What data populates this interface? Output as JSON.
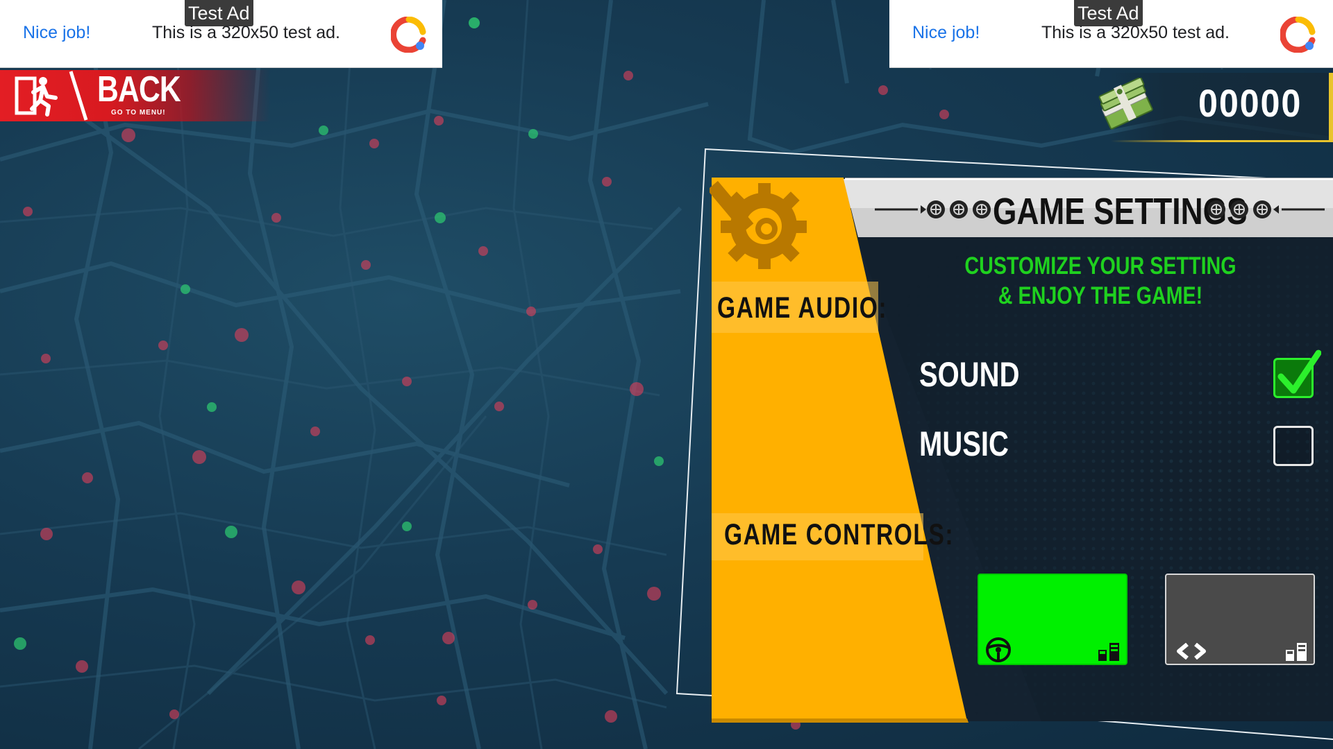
{
  "ads": [
    {
      "tag": "Test Ad",
      "nice": "Nice job!",
      "text": "This is a 320x50 test ad."
    },
    {
      "tag": "Test Ad",
      "nice": "Nice job!",
      "text": "This is a 320x50 test ad."
    }
  ],
  "back": {
    "label": "BACK",
    "sublabel": "GO TO MENU!",
    "icon": "exit-running-man-icon"
  },
  "currency": {
    "icon": "cash-stack-icon",
    "value": "00000"
  },
  "settings": {
    "title": "GAME SETTINGS",
    "subtitle": "CUSTOMIZE YOUR SETTING & ENJOY THE GAME!",
    "header_icon": "wrench-gear-icon",
    "title_decoration_icon": "tire-icon",
    "audio": {
      "label": "GAME AUDIO:",
      "options": [
        {
          "label": "SOUND",
          "checked": true
        },
        {
          "label": "MUSIC",
          "checked": false
        }
      ]
    },
    "controls": {
      "label": "GAME CONTROLS:",
      "options": [
        {
          "icon": "steering-wheel-icon",
          "pedals_icon": "pedals-icon",
          "selected": true
        },
        {
          "icon": "left-right-arrows-icon",
          "pedals_icon": "pedals-icon",
          "selected": false
        }
      ]
    }
  },
  "colors": {
    "panel_yellow": "#ffb000",
    "accent_green": "#1fd11f",
    "back_red": "#e31e24",
    "gold_line": "#e9c42c",
    "panel_dark": "#142230"
  }
}
